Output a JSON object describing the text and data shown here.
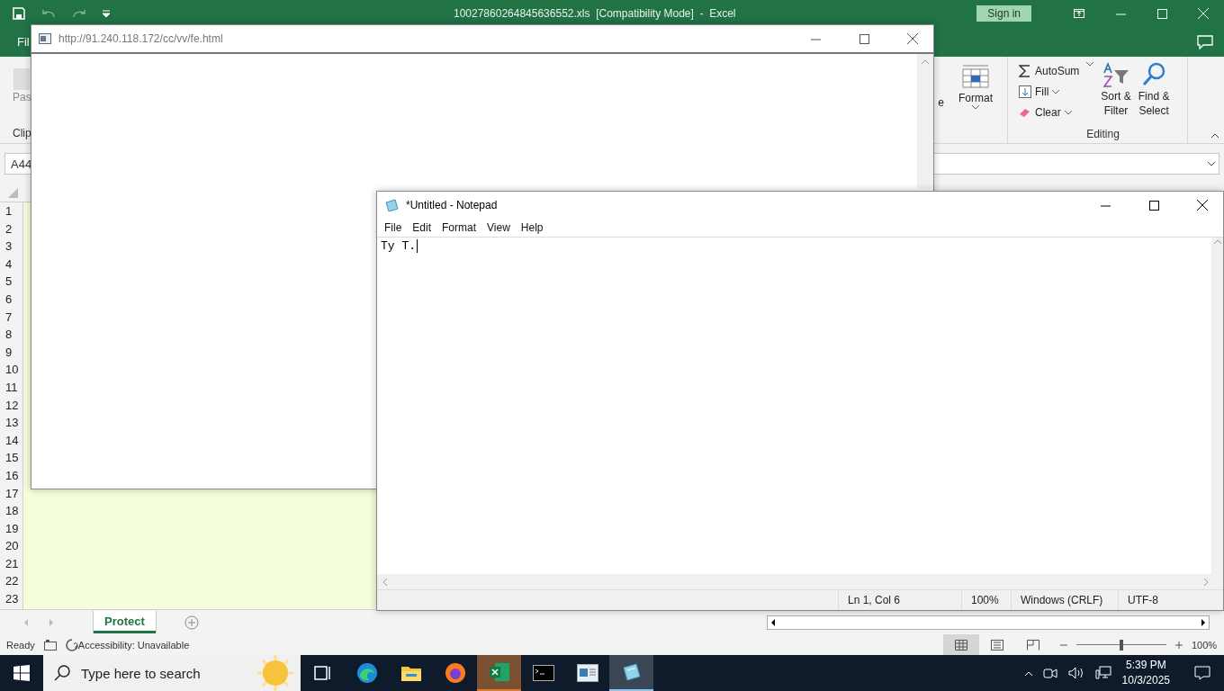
{
  "excel": {
    "title": "10027860264845636552.xls  [Compatibility Mode]  -  Excel",
    "sign_in": "Sign in",
    "tab_partial": "Fil",
    "ribbon": {
      "paste_partial": "Pas",
      "clipboard_partial": "Clip",
      "format_partial": "e",
      "format": "Format",
      "autosum": "AutoSum",
      "fill": "Fill",
      "clear": "Clear",
      "sort_lines": [
        "Sort &",
        "Filter"
      ],
      "find_lines": [
        "Find &",
        "Select"
      ],
      "group": "Editing"
    },
    "name_box": "A44",
    "rows": [
      "1",
      "2",
      "3",
      "4",
      "5",
      "6",
      "7",
      "8",
      "9",
      "10",
      "11",
      "12",
      "13",
      "14",
      "15",
      "16",
      "17",
      "18",
      "19",
      "20",
      "21",
      "22",
      "23"
    ],
    "sheet_tabs": [
      {
        "label": "Protect",
        "selected": true
      }
    ],
    "status": "Ready",
    "accessibility": "Accessibility: Unavailable",
    "views": [
      {
        "kind": "normal",
        "selected": true
      },
      {
        "kind": "page_layout",
        "selected": false
      },
      {
        "kind": "page_break",
        "selected": false
      }
    ],
    "zoom": {
      "level": 0.5,
      "reading": "100%"
    }
  },
  "popup": {
    "url": "http://91.240.118.172/cc/vv/fe.html"
  },
  "notepad": {
    "title": "*Untitled - Notepad",
    "menu": [
      "File",
      "Edit",
      "Format",
      "View",
      "Help"
    ],
    "text": "Ty T.",
    "status": [
      "Ln 1, Col 6",
      "100%",
      "Windows (CRLF)",
      "UTF-8"
    ]
  },
  "taskbar": {
    "search_placeholder": "Type here to search",
    "apps": [
      {
        "kind": "task_view",
        "active": false
      },
      {
        "kind": "edge",
        "active": false
      },
      {
        "kind": "explorer",
        "active": false
      },
      {
        "kind": "firefox",
        "active": false
      },
      {
        "kind": "excel",
        "active": true
      },
      {
        "kind": "terminal",
        "active": false
      },
      {
        "kind": "app",
        "active": false
      },
      {
        "kind": "notepad",
        "active": true
      }
    ],
    "time": "5:39 PM",
    "date": "10/3/2025"
  }
}
